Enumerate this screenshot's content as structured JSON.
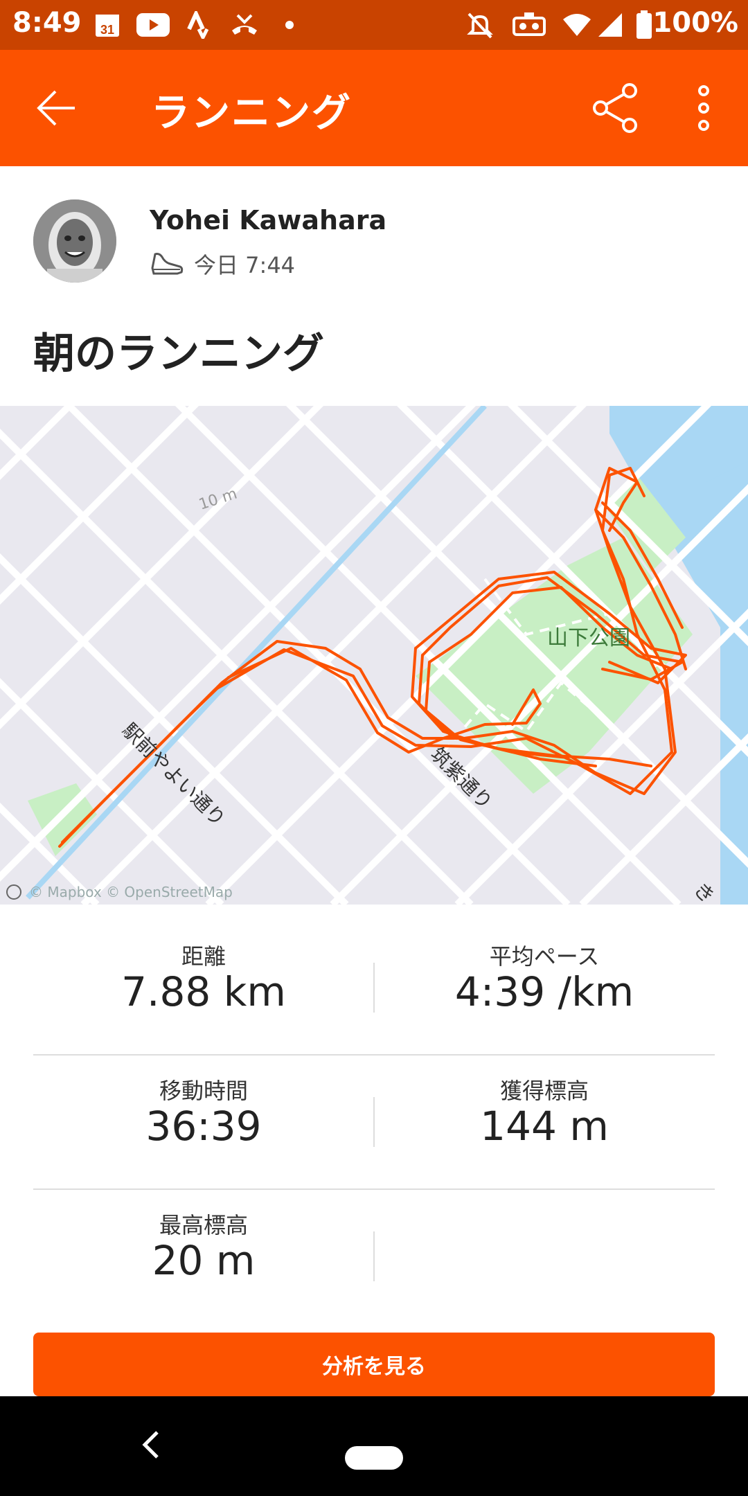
{
  "status_bar": {
    "time": "8:49",
    "calendar_day": "31",
    "battery": "100%",
    "icons": [
      "calendar-icon",
      "youtube-icon",
      "strava-icon",
      "missed-call-icon",
      "dot-icon",
      "mute-icon",
      "vr-icon",
      "wifi-icon",
      "signal-icon",
      "battery-icon"
    ]
  },
  "app_bar": {
    "title": "ランニング",
    "back_icon": "arrow-left-icon",
    "share_icon": "share-icon",
    "more_icon": "more-vertical-icon"
  },
  "activity": {
    "athlete_name": "Yohei Kawahara",
    "time_label": "今日 7:44",
    "activity_icon": "shoe-icon",
    "title": "朝のランニング"
  },
  "map": {
    "labels": {
      "contour": "10 m",
      "park": "山下公園",
      "street1": "駅前やよい通り",
      "street2": "筑紫通り",
      "edge": "き"
    },
    "attribution": "© Mapbox © OpenStreetMap",
    "route_color": "#fc5200",
    "park_color": "#c8efc4",
    "water_color": "#a9d7f4"
  },
  "stats": [
    {
      "label": "距離",
      "value": "7.88 km"
    },
    {
      "label": "平均ペース",
      "value": "4:39 /km"
    },
    {
      "label": "移動時間",
      "value": "36:39"
    },
    {
      "label": "獲得標高",
      "value": "144 m"
    },
    {
      "label": "最高標高",
      "value": "20 m"
    },
    {
      "label": "",
      "value": ""
    }
  ],
  "cta": {
    "label": "分析を見る"
  },
  "colors": {
    "brand": "#fc5200",
    "status_bar": "#c94300"
  }
}
